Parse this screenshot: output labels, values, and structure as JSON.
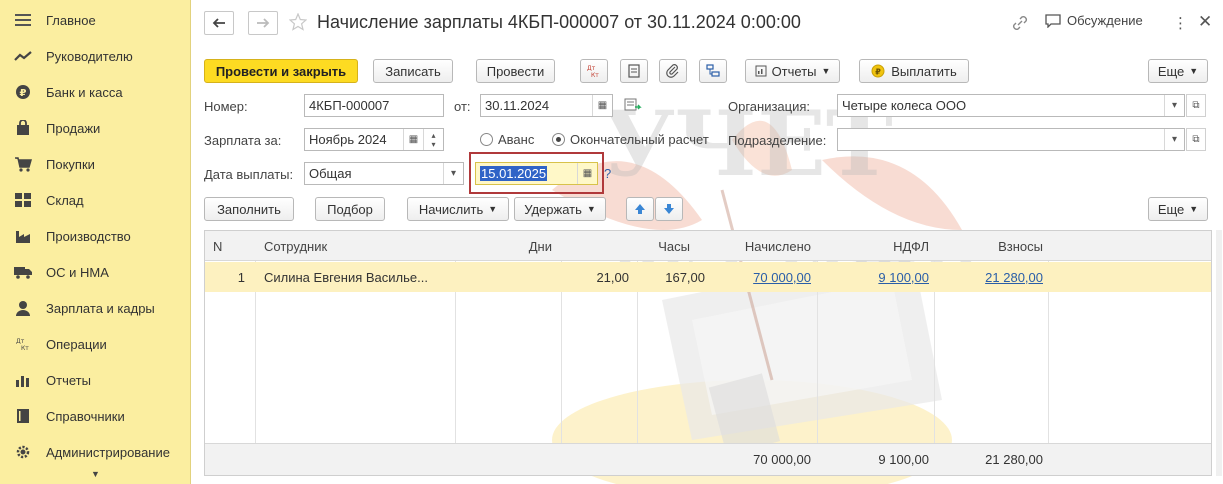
{
  "sidebar": {
    "items": [
      {
        "label": "Главное",
        "icon": "menu-icon"
      },
      {
        "label": "Руководителю",
        "icon": "trend-icon"
      },
      {
        "label": "Банк и касса",
        "icon": "coins-icon"
      },
      {
        "label": "Продажи",
        "icon": "bag-icon"
      },
      {
        "label": "Покупки",
        "icon": "cart-icon"
      },
      {
        "label": "Склад",
        "icon": "warehouse-icon"
      },
      {
        "label": "Производство",
        "icon": "factory-icon"
      },
      {
        "label": "ОС и НМА",
        "icon": "truck-icon"
      },
      {
        "label": "Зарплата и кадры",
        "icon": "person-icon"
      },
      {
        "label": "Операции",
        "icon": "dt-kt-icon"
      },
      {
        "label": "Отчеты",
        "icon": "bar-chart-icon"
      },
      {
        "label": "Справочники",
        "icon": "book-icon"
      },
      {
        "label": "Администрирование",
        "icon": "gear-icon"
      }
    ]
  },
  "header": {
    "title": "Начисление зарплаты 4КБП-000007 от 30.11.2024 0:00:00",
    "discussion": "Обсуждение"
  },
  "toolbar": {
    "post_and_close": "Провести и закрыть",
    "save": "Записать",
    "post": "Провести",
    "reports": "Отчеты",
    "pay": "Выплатить",
    "more": "Еще"
  },
  "form": {
    "number_label": "Номер:",
    "number_value": "4КБП-000007",
    "date_label": "от:",
    "date_value": "30.11.2024",
    "org_label": "Организация:",
    "org_value": "Четыре колеса ООО",
    "period_label": "Зарплата за:",
    "period_value": "Ноябрь 2024",
    "advance_label": "Аванс",
    "final_label": "Окончательный расчет",
    "dept_label": "Подразделение:",
    "dept_value": "",
    "paydate_label": "Дата выплаты:",
    "paydate_kind": "Общая",
    "paydate_value": "15.01.2025",
    "help": "?"
  },
  "table_toolbar": {
    "fill": "Заполнить",
    "select": "Подбор",
    "accrue": "Начислить",
    "withhold": "Удержать",
    "more": "Еще"
  },
  "table": {
    "columns": [
      "N",
      "Сотрудник",
      "Дни",
      "Часы",
      "Начислено",
      "НДФЛ",
      "Взносы"
    ],
    "rows": [
      {
        "n": "1",
        "employee": "Силина Евгения Василье...",
        "days": "21,00",
        "hours": "167,00",
        "accrued": "70 000,00",
        "ndfl": "9 100,00",
        "contrib": "21 280,00"
      }
    ],
    "totals": {
      "accrued": "70 000,00",
      "ndfl": "9 100,00",
      "contrib": "21 280,00"
    }
  },
  "watermark": {
    "line1": "УЧЕТ",
    "line2": "БЕЗ ЗАБОТ"
  },
  "colors": {
    "sidebar_bg": "#fbeea0",
    "primary_button": "#fddb22",
    "selected_row": "#fdf1c0",
    "link": "#2a5ea8",
    "highlight_box": "#b0393b"
  }
}
